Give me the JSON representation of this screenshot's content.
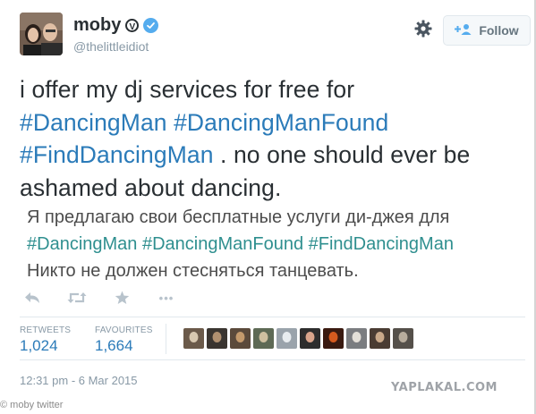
{
  "user": {
    "display_name": "moby",
    "handle": "@thelittleidiot",
    "vegan_mark": "V"
  },
  "follow_button": {
    "label": "Follow"
  },
  "tweet": {
    "line1": "i offer my dj services for free for",
    "hashtag1": "#DancingMan",
    "hashtag2": "#DancingManFound",
    "hashtag3": "#FindDancingMan",
    "rest3": " . no one should ever be",
    "line4": "ashamed about dancing."
  },
  "translation": {
    "line1": "Я предлагаю свои бесплатные услуги ди-джея для",
    "hashtags": "#DancingMan #DancingManFound #FindDancingMan",
    "line3": "Никто не должен стесняться танцевать."
  },
  "actions": {
    "more_label": "•••"
  },
  "stats": {
    "retweets_label": "RETWEETS",
    "retweets_count": "1,024",
    "favourites_label": "FAVOURITES",
    "favourites_count": "1,664"
  },
  "favouriters": [
    {
      "c1": "#6b5a4a",
      "c2": "#d8c8b0"
    },
    {
      "c1": "#3a3530",
      "c2": "#b09070"
    },
    {
      "c1": "#5b4a3b",
      "c2": "#c49a6c"
    },
    {
      "c1": "#5e6a55",
      "c2": "#cfc0a0"
    },
    {
      "c1": "#9aa3ab",
      "c2": "#e8ecef"
    },
    {
      "c1": "#2d2d2d",
      "c2": "#d9a48b"
    },
    {
      "c1": "#3a1a10",
      "c2": "#d65a1e"
    },
    {
      "c1": "#7b7d80",
      "c2": "#e4e0d8"
    },
    {
      "c1": "#4a3c33",
      "c2": "#caa98a"
    },
    {
      "c1": "#55504a",
      "c2": "#b8ad9d"
    }
  ],
  "timestamp": "12:31 pm - 6 Mar 2015",
  "watermark": "YAPLAKAL.COM",
  "credit": "moby twitter",
  "colors": {
    "link": "#2b7bb9",
    "verified": "#55acee",
    "muted": "#8899a6"
  }
}
